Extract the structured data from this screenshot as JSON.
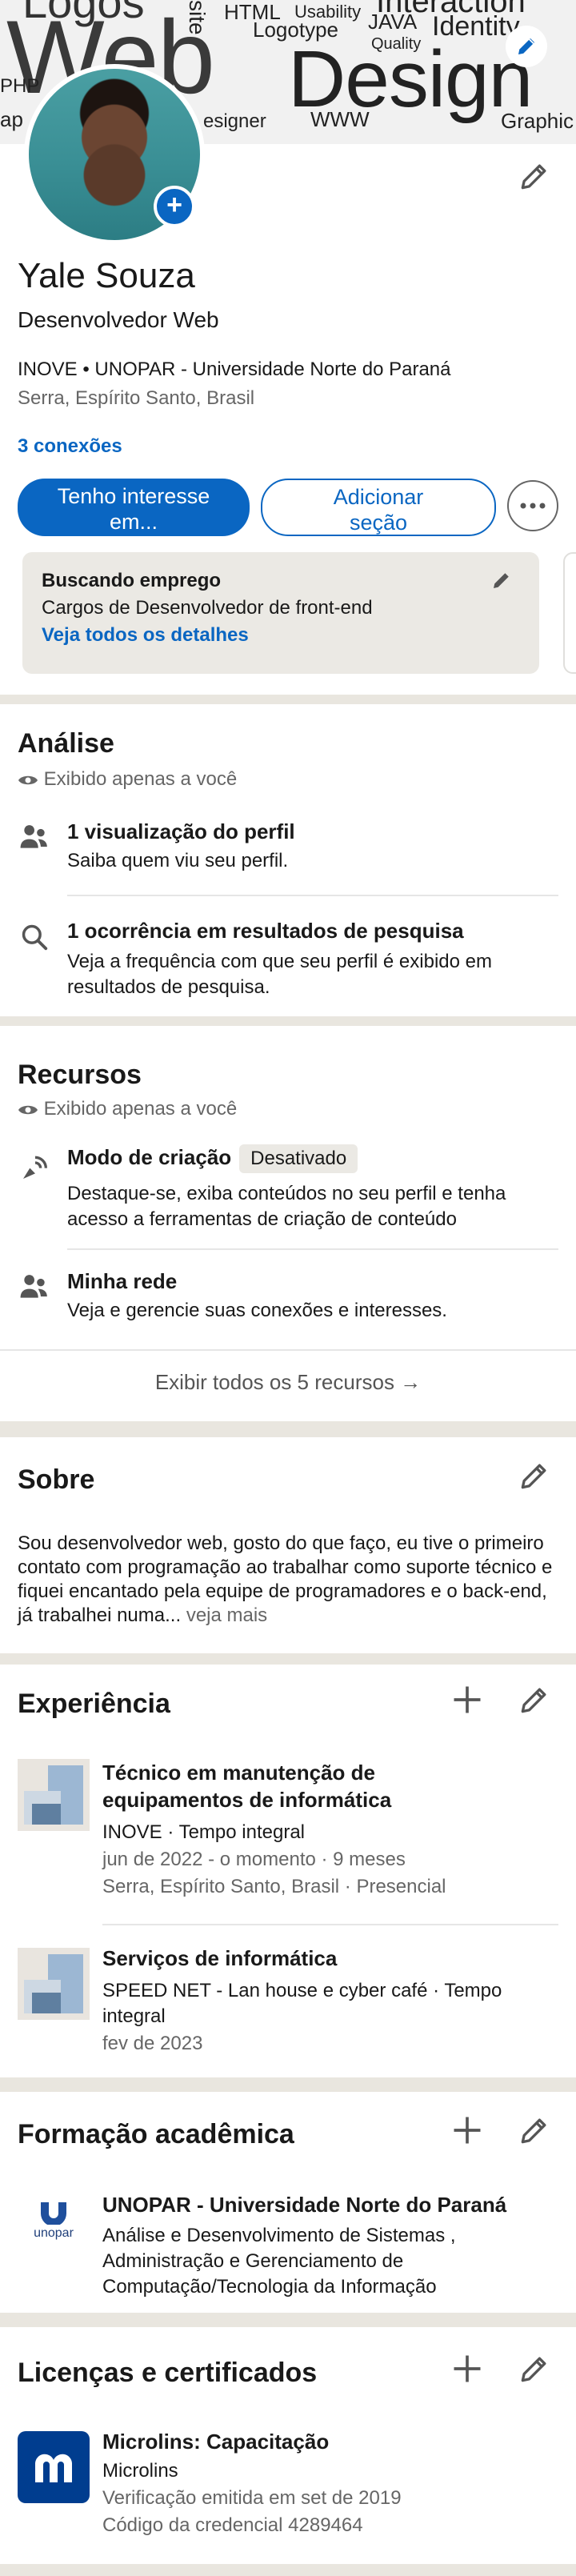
{
  "banner": {
    "words": [
      "Logos",
      "HTML",
      "Usability",
      "Interaction",
      "site",
      "Logotype",
      "JAVA",
      "Identity",
      "Quality",
      "Web",
      "Design",
      "PHP",
      "esigner",
      "WWW",
      "Graphic",
      "ap"
    ]
  },
  "profile": {
    "name": "Yale Souza",
    "headline": "Desenvolvedor Web",
    "org": "INOVE • UNOPAR - Universidade Norte do Paraná",
    "location": "Serra, Espírito Santo, Brasil",
    "connections": "3 conexões",
    "buttons": {
      "interest": "Tenho interesse em...",
      "add_section": "Adicionar seção"
    },
    "open_to_work": {
      "title": "Buscando emprego",
      "roles": "Cargos de Desenvolvedor de front-end",
      "details_link": "Veja todos os detalhes"
    }
  },
  "analytics": {
    "title": "Análise",
    "private_note": "Exibido apenas a você",
    "items": [
      {
        "title": "1 visualização do perfil",
        "desc": "Saiba quem viu seu perfil."
      },
      {
        "title": "1 ocorrência em resultados de pesquisa",
        "desc": "Veja a frequência com que seu perfil é exibido em resultados de pesquisa."
      }
    ]
  },
  "resources": {
    "title": "Recursos",
    "private_note": "Exibido apenas a você",
    "creator_mode": {
      "title": "Modo de criação",
      "badge": "Desativado",
      "desc": "Destaque-se, exiba conteúdos no seu perfil e tenha acesso a ferramentas de criação de conteúdo"
    },
    "network": {
      "title": "Minha rede",
      "desc": "Veja e gerencie suas conexões e interesses."
    },
    "show_all": "Exibir todos os 5 recursos →"
  },
  "about": {
    "title": "Sobre",
    "text": "Sou desenvolvedor web, gosto do que faço, eu tive o primeiro contato com programação ao trabalhar como suporte técnico e fiquei encantado pela equipe de programadores e o back-end, já trabalhei numa",
    "ellipsis": "...",
    "see_more": "veja mais"
  },
  "experience": {
    "title": "Experiência",
    "items": [
      {
        "title": "Técnico em manutenção de equipamentos de informática",
        "company": "INOVE · Tempo integral",
        "dates": "jun de 2022 - o momento · 9 meses",
        "place": "Serra, Espírito Santo, Brasil · Presencial"
      },
      {
        "title": "Serviços de informática",
        "company": "SPEED NET - Lan house e cyber café · Tempo integral",
        "dates": "fev de 2023"
      }
    ]
  },
  "education": {
    "title": "Formação acadêmica",
    "items": [
      {
        "school": "UNOPAR - Universidade Norte do Paraná",
        "degree": "Análise e Desenvolvimento de Sistemas , Administração e Gerenciamento de Computação/Tecnologia da Informação",
        "logo_text": "unopar"
      }
    ]
  },
  "licenses": {
    "title": "Licenças e certificados",
    "items": [
      {
        "title": "Microlins: Capacitação",
        "issuer": "Microlins",
        "issued": "Verificação emitida em set de 2019",
        "credential": "Código da credencial 4289464"
      }
    ]
  },
  "colors": {
    "brand": "#0a66c2",
    "text": "#191919",
    "muted": "#666666",
    "divider": "#e9e6df"
  }
}
